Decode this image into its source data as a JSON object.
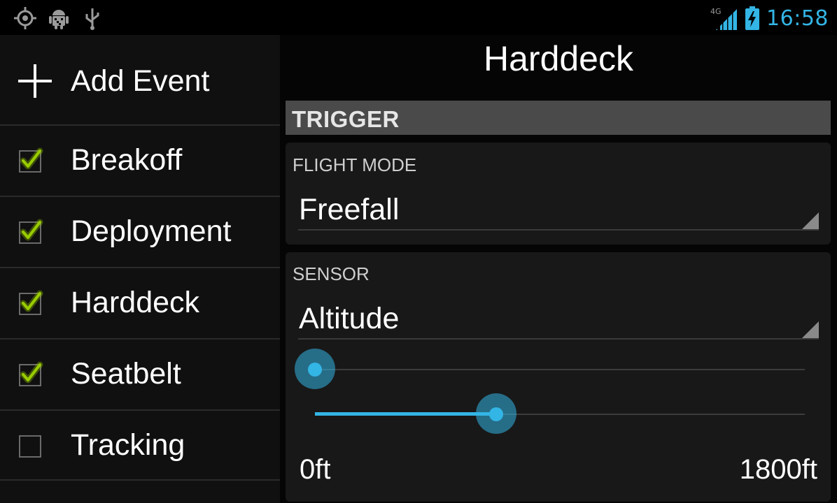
{
  "status_bar": {
    "clock": "16:58",
    "network": "4G",
    "icons": [
      "gps-icon",
      "android-debug-icon",
      "usb-icon",
      "signal-icon",
      "battery-charging-icon"
    ]
  },
  "sidebar": {
    "add_label": "Add Event",
    "items": [
      {
        "label": "Breakoff",
        "checked": true
      },
      {
        "label": "Deployment",
        "checked": true
      },
      {
        "label": "Harddeck",
        "checked": true
      },
      {
        "label": "Seatbelt",
        "checked": true
      },
      {
        "label": "Tracking",
        "checked": false
      }
    ]
  },
  "main": {
    "title": "Harddeck",
    "section": "TRIGGER",
    "flight_mode": {
      "label": "FLIGHT MODE",
      "value": "Freefall"
    },
    "sensor": {
      "label": "SENSOR",
      "value": "Altitude"
    },
    "slider_min_fraction": 0.0,
    "slider_max_fraction": 0.37,
    "range_min": "0ft",
    "range_max": "1800ft"
  },
  "colors": {
    "accent": "#33b5e5",
    "check": "#99cc00"
  }
}
